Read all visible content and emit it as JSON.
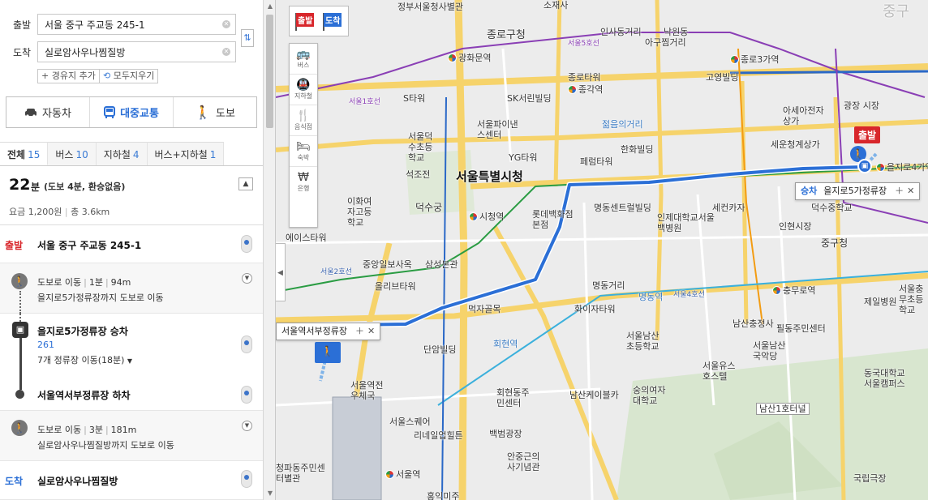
{
  "search": {
    "start_label": "출발",
    "start_value": "서울 중구 주교동 245-1",
    "end_label": "도착",
    "end_value": "실로암사우나찜질방",
    "add_waypoint": "+ 경유지 추가",
    "clear_all": "모두지우기"
  },
  "modes": [
    {
      "label": "자동차",
      "icon": "car-icon"
    },
    {
      "label": "대중교통",
      "icon": "bus-icon"
    },
    {
      "label": "도보",
      "icon": "walk-icon"
    }
  ],
  "tabs": [
    {
      "label": "전체",
      "count": "15"
    },
    {
      "label": "버스",
      "count": "10"
    },
    {
      "label": "지하철",
      "count": "4"
    },
    {
      "label": "버스+지하철",
      "count": "1"
    }
  ],
  "summary": {
    "minutes": "22",
    "unit": "분",
    "detail": "(도보 4분, 환승없음)",
    "fare": "요금 1,200원",
    "sep": "|",
    "distance": "총 3.6km",
    "collapse_icon": "chevron-up-icon"
  },
  "steps": {
    "start": {
      "tag": "출발",
      "title": "서울 중구 주교동 245-1"
    },
    "walk1": {
      "mode": "도보로 이동",
      "time": "1분",
      "dist": "94m",
      "desc": "을지로5가정류장까지 도보로 이동"
    },
    "board": {
      "title": "을지로5가정류장 승차",
      "route": "261",
      "stops": "7개 정류장 이동(18분)"
    },
    "alight": {
      "title": "서울역서부정류장 하차"
    },
    "walk2": {
      "mode": "도보로 이동",
      "time": "3분",
      "dist": "181m",
      "desc": "실로암사우나찜질방까지 도보로 이동"
    },
    "end": {
      "tag": "도착",
      "title": "실로암사우나찜질방"
    }
  },
  "map": {
    "categories": [
      {
        "label": "버스",
        "icon": "bus-icon"
      },
      {
        "label": "지하철",
        "icon": "subway-icon"
      },
      {
        "label": "음식점",
        "icon": "restaurant-icon"
      },
      {
        "label": "숙박",
        "icon": "bed-icon"
      },
      {
        "label": "은행",
        "icon": "bank-icon"
      }
    ],
    "flag_start": "출발",
    "flag_end": "도착",
    "popup_board": {
      "kind": "승차",
      "name": "을지로5가정류장"
    },
    "popup_alight": {
      "name": "서울역서부정류장"
    },
    "labels": [
      "정부서울청사별관",
      "소재사",
      "인사동거리",
      "낙원동",
      "아구찜거리",
      "종로구청",
      "광화문역",
      "종로3가역",
      "종로타워",
      "종각역",
      "고영빌딩",
      "S타워",
      "SK서린빌딩",
      "광장 시장",
      "아세아전자상가",
      "서울파이낸스센터",
      "젊음의거리",
      "서울덕수초등학교",
      "한화빌딩",
      "세운청계상가",
      "YG타워",
      "석조전",
      "서울특별시청",
      "페럼타워",
      "을지로4가역",
      "덕수궁",
      "시청역",
      "롯데백화점본점",
      "명동센트럴빌딩",
      "인제대학교서울백병원",
      "세컨카자",
      "덕수중학교",
      "이화여자고등학교",
      "인현시장",
      "에이스타워",
      "중구청",
      "중앙일보사옥",
      "삼성본관",
      "명동거리",
      "충무로역",
      "서울충무초등학교",
      "올리브타워",
      "명동역",
      "먹자골목",
      "화이자타워",
      "제일병원",
      "남산충정사",
      "필동주민센터",
      "단암빌딩",
      "회현역",
      "서울남산초등학교",
      "서울남산국악당",
      "서울역전우체국",
      "회현동주민센터",
      "남산케이블카",
      "숭의여자대학교",
      "서울유스호스텔",
      "동국대학교서울캠퍼스",
      "서울스퀘어",
      "남산1호터널",
      "리네일업힐튼",
      "백범광장",
      "서울역",
      "안중근의사기념관",
      "청파동주민센터별관",
      "국립극장",
      "홍익미주",
      "중구"
    ],
    "road_labels": [
      "서울1호선",
      "서울2호선",
      "서울3호선",
      "서울4호선",
      "서울5호선",
      "명동역"
    ],
    "colors": {
      "route": "#2b6fd6",
      "start_flag": "#d8262b",
      "line1": "#2a68c7",
      "line2": "#2a9c43",
      "line3": "#f39c12",
      "line4": "#3bb0dc",
      "line5": "#8a3fb5"
    }
  }
}
